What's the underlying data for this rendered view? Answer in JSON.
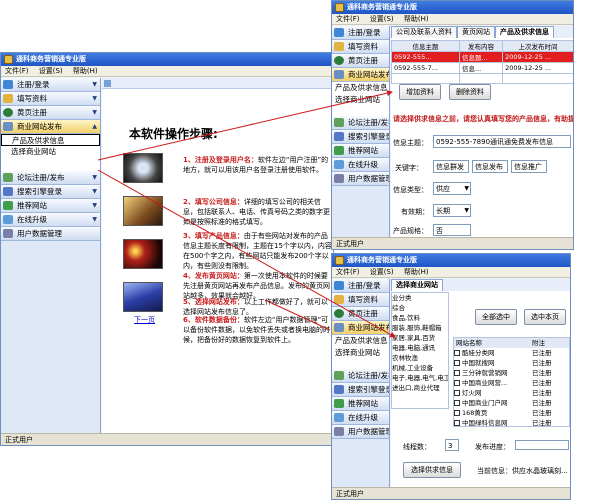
{
  "app_title": "通科商务营销通专业版",
  "menu": [
    "文件(F)",
    "设置(S)",
    "帮助(H)"
  ],
  "sidebar": [
    {
      "label": "注册/登录",
      "color": "#3f86d6"
    },
    {
      "label": "填写资料",
      "color": "#e2b33e"
    },
    {
      "label": "黄页注册",
      "color": "#2d7d3a"
    },
    {
      "label": "商业网站发布",
      "color": "#6a8fc6"
    },
    {
      "label": "论坛注册/发布",
      "color": "#5fa05a"
    },
    {
      "label": "搜索引擎登录",
      "color": "#5478c8"
    },
    {
      "label": "推荐网站",
      "color": "#3f9e4a"
    },
    {
      "label": "在线升级",
      "color": "#5d9dd9"
    },
    {
      "label": "用户数据管理",
      "color": "#7b7fa8"
    }
  ],
  "submenu": [
    "产品及供求信息",
    "选择商业网站"
  ],
  "status": "正式用户",
  "main": {
    "heading": "本软件操作步骤:",
    "steps": [
      {
        "title": "1、注册及登录用户名：",
        "text": "软件左边“用户注册”的地方，就可以用该用户名登录注册使用软件。"
      },
      {
        "title": "2、填写公司信息：",
        "text": "详细的填写公司的相关信息，包括联系人、电话、传真号码之类的数字更如是按照标准的格式填写。"
      },
      {
        "title": "3、填写产品信息：",
        "text": "由于有些网站对发布的产品信息主题长度有限制，主题在15个字以内，内容在500个字之内，有些网站只能发布200个字以内，有些则没有限制。"
      },
      {
        "title": "4、发布黄页网站：",
        "text": "第一次使用本软件的时候要先注册黄页网站再发布产品信息。发布的黄页网站越多，效果就会越好。"
      },
      {
        "title": "5、选择网站发布：",
        "text": "以上工作都做好了，就可以选择网站发布信息了。"
      },
      {
        "title": "6、软件数据备份：",
        "text": "软件左边“用户数据管理”可以备份软件数据，以免软件丢失或者换电脑的时候，把备份好的数据恢复到软件上。"
      }
    ],
    "next_page": "下一页"
  },
  "win2": {
    "tabs": [
      "公司及联系人资料",
      "黄页网站",
      "产品及供求信息"
    ],
    "columns": [
      "信息主题",
      "发布内容",
      "上次发布时间"
    ],
    "rows": [
      [
        "0592-555...",
        "信息题...",
        "2009-12-25 ..."
      ],
      [
        "0592-555-7...",
        "信息...",
        "2009-12-25 ..."
      ]
    ],
    "add_button": "增加资料",
    "delete_button": "删除资料",
    "notice": "请选择供求信息之前，请您认真填写您的产品信息，有助提高...",
    "fields": [
      {
        "label": "信息主题：",
        "value": "0592-555-7890通讯通免费发布信息"
      },
      {
        "label": "关键字：",
        "value": "信息群发"
      },
      {
        "label": "信息类型：",
        "value": "供应"
      },
      {
        "label": "有效期：",
        "value": "长期"
      },
      {
        "label": "产品规格：",
        "value": "否"
      }
    ],
    "keyword_extra": [
      "信息发布",
      "信息推广"
    ]
  },
  "win3": {
    "tab": "选择商业网站",
    "categories": [
      "业分类",
      "综合",
      "食品,饮料",
      "服装,服饰,鞋帽箱",
      "家居,家具,百货",
      "电器,电脑,通讯",
      "农林牧渔",
      "机械,工业设备",
      "电子,电器,电气,电工",
      "进出口,商业代理"
    ],
    "select_all": "全部选中",
    "select_this": "选中本页",
    "site_columns": [
      "网站名称",
      "附注"
    ],
    "sites": [
      {
        "name": "酷娃分类网",
        "note": "已注册"
      },
      {
        "name": "中国就搜网",
        "note": "已注册"
      },
      {
        "name": "三分钟就营销网",
        "note": "已注册"
      },
      {
        "name": "中国商业网营...",
        "note": "已注册"
      },
      {
        "name": "灯火网",
        "note": "已注册"
      },
      {
        "name": "中国商业门户网",
        "note": "已注册"
      },
      {
        "name": "168黄页",
        "note": "已注册"
      },
      {
        "name": "中国绿科信息网",
        "note": "已注册"
      }
    ],
    "threads_label": "线程数：",
    "threads_value": "3",
    "publish_label": "发布进度：",
    "choose_button": "选择供求信息",
    "current_info_label": "当前信息：供应水晶玻璃刻...",
    "status": "正式用户"
  },
  "main_title_heading_color": "#000000",
  "arrow_color": "#cc1a1a"
}
